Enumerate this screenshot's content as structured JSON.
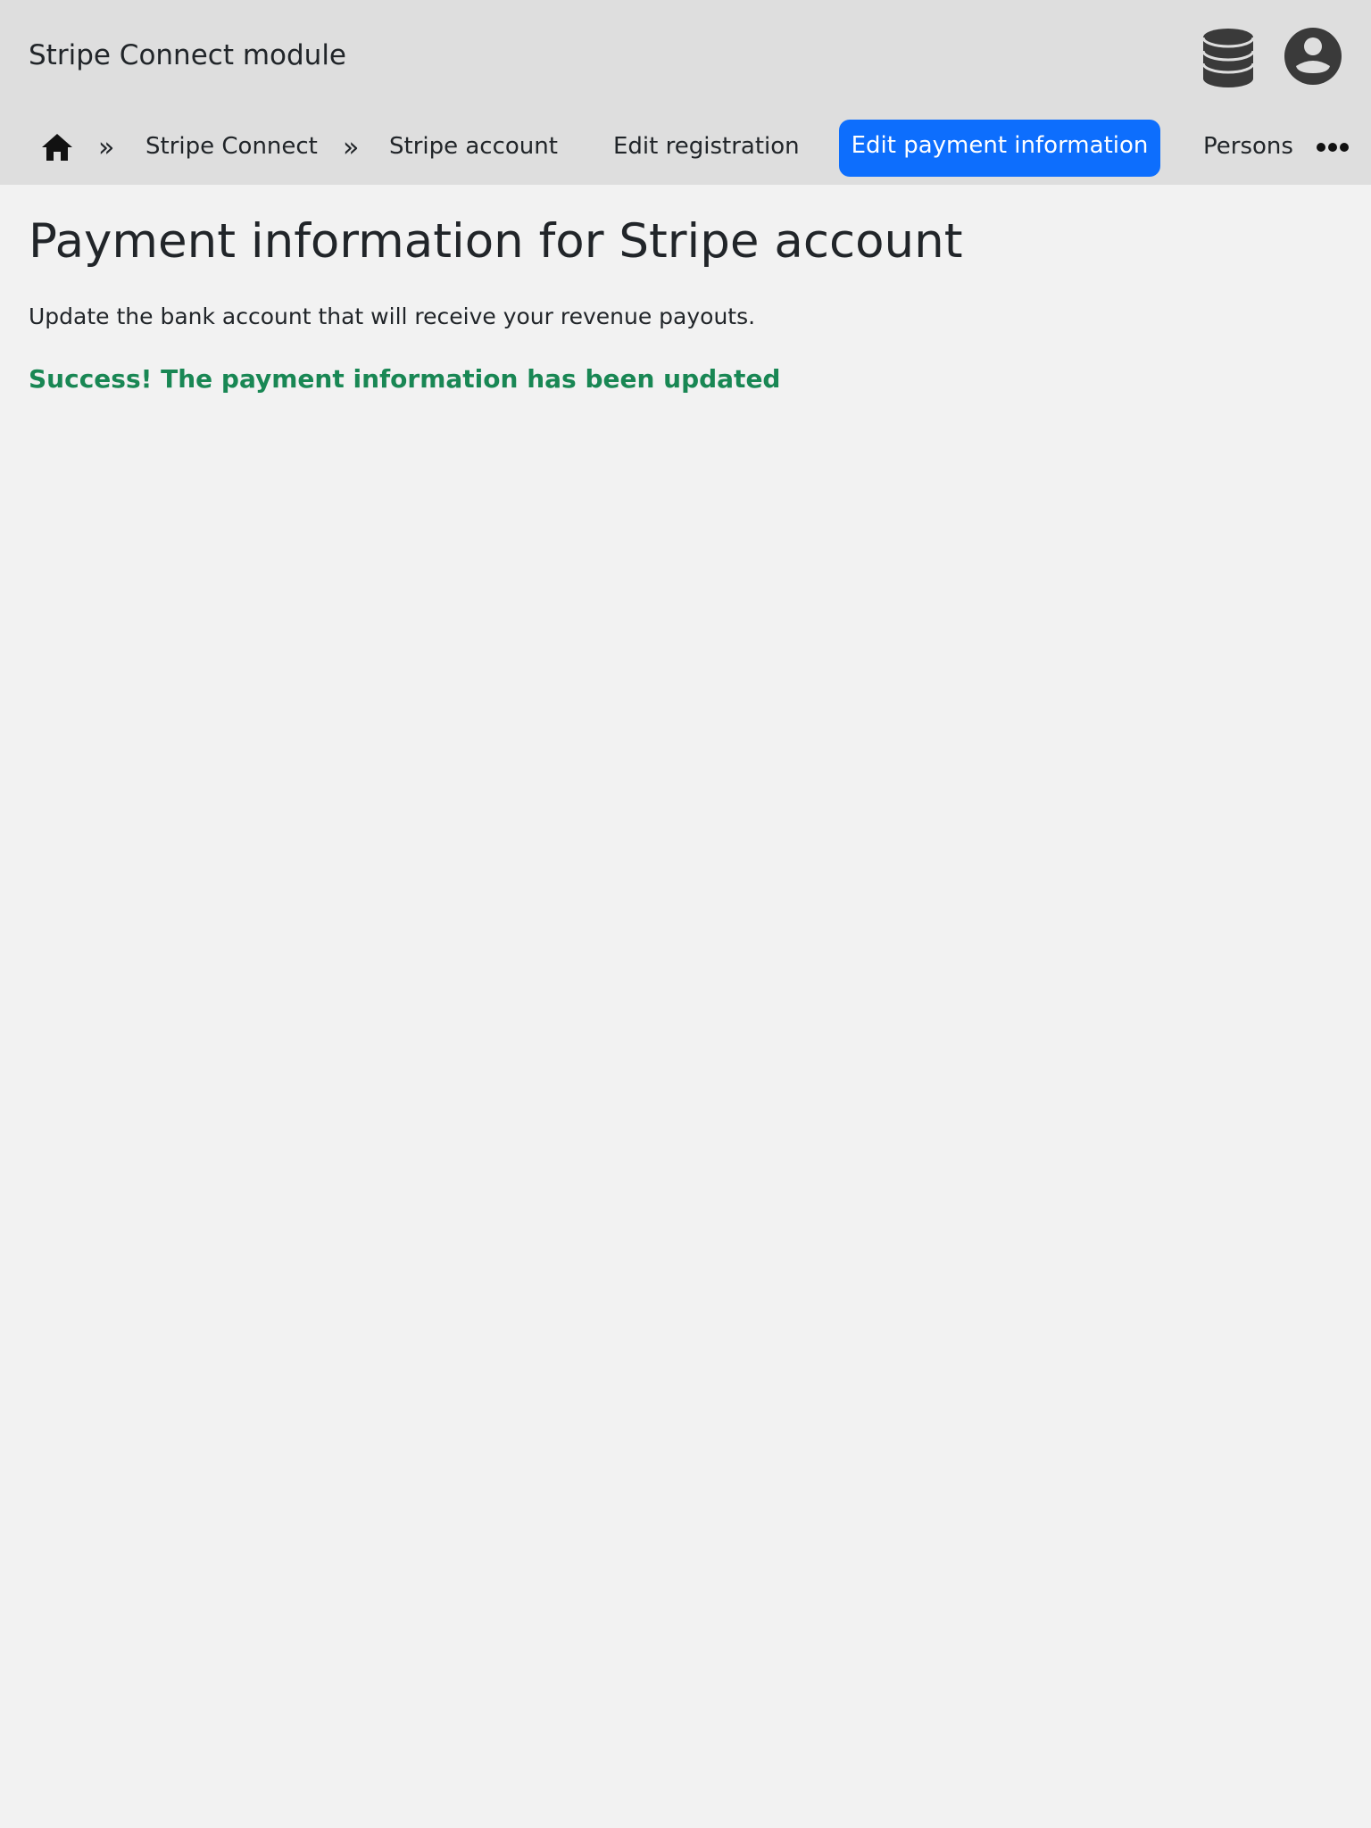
{
  "header": {
    "title": "Stripe Connect module",
    "icons": [
      "database-icon",
      "user-account-icon"
    ]
  },
  "breadcrumb": {
    "home_icon": "home-icon",
    "separator": "»",
    "items": [
      "Stripe Connect",
      "Stripe account"
    ]
  },
  "tabs": [
    {
      "label": "Edit registration",
      "active": false
    },
    {
      "label": "Edit payment information",
      "active": true
    },
    {
      "label": "Persons",
      "active": false
    }
  ],
  "more_icon": "more-horizontal-icon",
  "main": {
    "title": "Payment information for Stripe account",
    "description": "Update the bank account that will receive your revenue payouts.",
    "success_message": "Success! The payment information has been updated"
  },
  "colors": {
    "accent": "#0d6efd",
    "success": "#198754",
    "header_bg": "#dedede",
    "page_bg": "#f2f2f2"
  }
}
